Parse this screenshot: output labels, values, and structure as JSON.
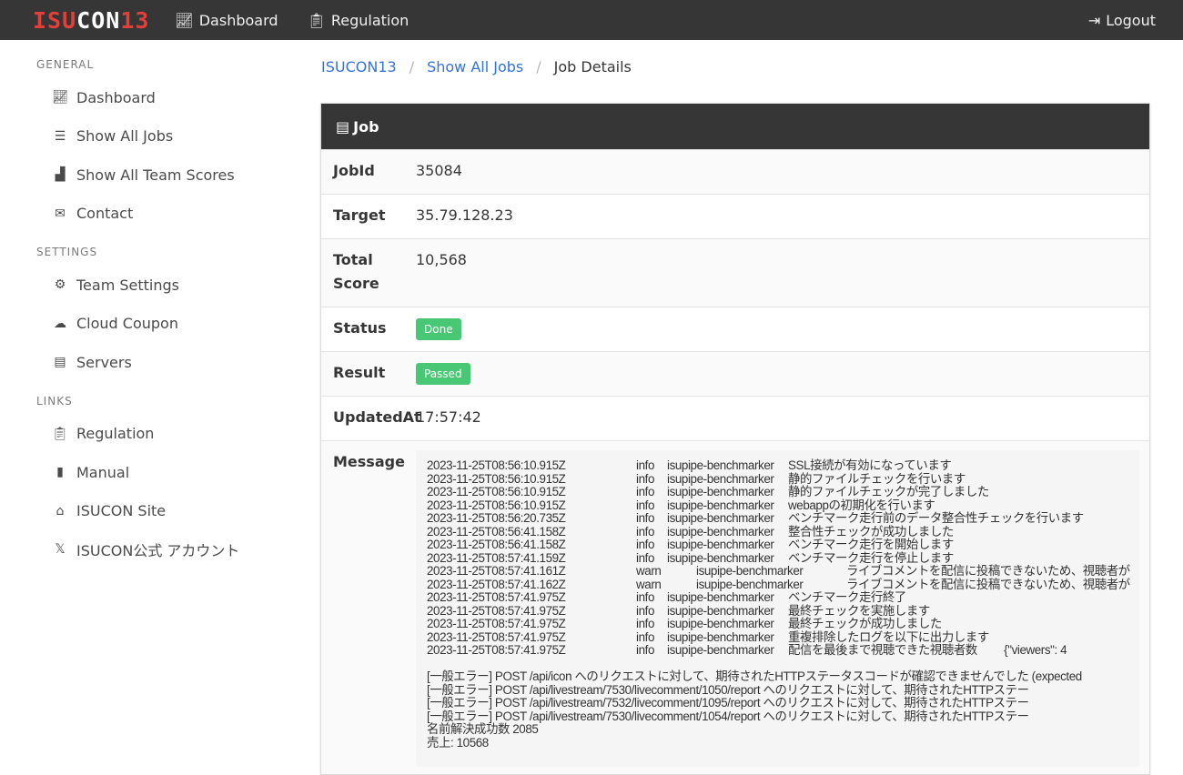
{
  "nav": {
    "logo_a": "ISU",
    "logo_b": "CON",
    "logo_c": "13",
    "dashboard": "Dashboard",
    "regulation": "Regulation",
    "logout": "Logout"
  },
  "sidebar": {
    "general": "GENERAL",
    "settings": "SETTINGS",
    "links": "LINKS",
    "general_items": [
      {
        "label": "Dashboard",
        "icon": "chart-line-icon"
      },
      {
        "label": "Show All Jobs",
        "icon": "list-icon"
      },
      {
        "label": "Show All Team Scores",
        "icon": "chart-area-icon"
      },
      {
        "label": "Contact",
        "icon": "envelope-icon"
      }
    ],
    "settings_items": [
      {
        "label": "Team Settings",
        "icon": "cogs-icon"
      },
      {
        "label": "Cloud Coupon",
        "icon": "cloud-icon"
      },
      {
        "label": "Servers",
        "icon": "server-icon"
      }
    ],
    "link_items": [
      {
        "label": "Regulation",
        "icon": "clipboard-icon"
      },
      {
        "label": "Manual",
        "icon": "book-icon"
      },
      {
        "label": "ISUCON Site",
        "icon": "home-icon"
      },
      {
        "label": "ISUCON公式 アカウント",
        "icon": "x-icon"
      }
    ]
  },
  "breadcrumb": [
    "ISUCON13",
    "Show All Jobs",
    "Job Details"
  ],
  "job": {
    "title": "Job",
    "rows": [
      {
        "label": "JobId",
        "value": "35084"
      },
      {
        "label": "Target",
        "value": "35.79.128.23"
      },
      {
        "label": "Total Score",
        "value": "10,568"
      }
    ],
    "status_label": "Status",
    "status": "Done",
    "result_label": "Result",
    "result": "Passed",
    "updated_label": "UpdatedAt",
    "updated": "17:57:42",
    "message_label": "Message",
    "log": [
      [
        "2023-11-25T08:56:10.915Z",
        "info",
        "isupipe-benchmarker",
        "SSL接続が有効になっています"
      ],
      [
        "2023-11-25T08:56:10.915Z",
        "info",
        "isupipe-benchmarker",
        "静的ファイルチェックを行います"
      ],
      [
        "2023-11-25T08:56:10.915Z",
        "info",
        "isupipe-benchmarker",
        "静的ファイルチェックが完了しました"
      ],
      [
        "2023-11-25T08:56:10.915Z",
        "info",
        "isupipe-benchmarker",
        "webappの初期化を行います"
      ],
      [
        "2023-11-25T08:56:20.735Z",
        "info",
        "isupipe-benchmarker",
        "ベンチマーク走行前のデータ整合性チェックを行います"
      ],
      [
        "2023-11-25T08:56:41.158Z",
        "info",
        "isupipe-benchmarker",
        "整合性チェックが成功しました"
      ],
      [
        "2023-11-25T08:56:41.158Z",
        "info",
        "isupipe-benchmarker",
        "ベンチマーク走行を開始します"
      ],
      [
        "2023-11-25T08:57:41.159Z",
        "info",
        "isupipe-benchmarker",
        "ベンチマーク走行を停止します"
      ],
      [
        "2023-11-25T08:57:41.161Z",
        "warn",
        "isupipe-benchmarker",
        "ライブコメントを配信に投稿できないため、視聴者が"
      ],
      [
        "2023-11-25T08:57:41.162Z",
        "warn",
        "isupipe-benchmarker",
        "ライブコメントを配信に投稿できないため、視聴者が"
      ],
      [
        "2023-11-25T08:57:41.975Z",
        "info",
        "isupipe-benchmarker",
        "ベンチマーク走行終了"
      ],
      [
        "2023-11-25T08:57:41.975Z",
        "info",
        "isupipe-benchmarker",
        "最終チェックを実施します"
      ],
      [
        "2023-11-25T08:57:41.975Z",
        "info",
        "isupipe-benchmarker",
        "最終チェックが成功しました"
      ],
      [
        "2023-11-25T08:57:41.975Z",
        "info",
        "isupipe-benchmarker",
        "重複排除したログを以下に出力します"
      ],
      [
        "2023-11-25T08:57:41.975Z",
        "info",
        "isupipe-benchmarker",
        "配信を最後まで視聴できた視聴者数　　 {\"viewers\": 4"
      ]
    ],
    "errors": [
      "[一般エラー] POST /api/icon へのリクエストに対して、期待されたHTTPステータスコードが確認できませんでした (expected",
      "[一般エラー] POST /api/livestream/7530/livecomment/1050/report へのリクエストに対して、期待されたHTTPステー",
      "[一般エラー] POST /api/livestream/7532/livecomment/1095/report へのリクエストに対して、期待されたHTTPステー",
      "[一般エラー] POST /api/livestream/7530/livecomment/1054/report へのリクエストに対して、期待されたHTTPステー",
      "名前解決成功数 2085",
      "売上: 10568"
    ]
  },
  "colors": {
    "navbar": "#363636",
    "logo_red": "#e0403a",
    "link": "#3273dc",
    "success": "#48c774"
  }
}
